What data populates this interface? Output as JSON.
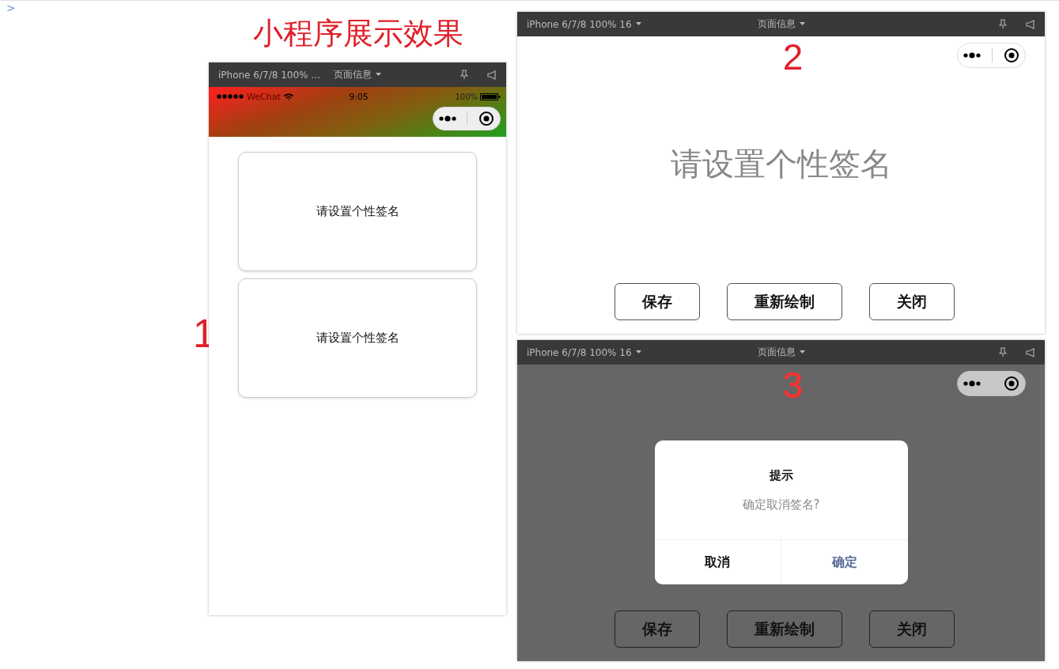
{
  "console_prompt": ">",
  "title": "小程序展示效果",
  "windows": [
    {
      "kind": "list",
      "number": "1",
      "device": "iPhone 6/7/8 100% ...",
      "device_caret": false,
      "page_menu": "页面信息",
      "status_bar": {
        "carrier": "WeChat",
        "time": "9:05",
        "battery": "100%"
      },
      "cards": [
        "请设置个性签名",
        "请设置个性签名"
      ]
    },
    {
      "kind": "canvas",
      "number": "2",
      "device": "iPhone 6/7/8 100% 16",
      "device_caret": true,
      "page_menu": "页面信息",
      "hint": "请设置个性签名",
      "buttons": [
        "保存",
        "重新绘制",
        "关闭"
      ]
    },
    {
      "kind": "dialog",
      "number": "3",
      "device": "iPhone 6/7/8 100% 16",
      "device_caret": true,
      "page_menu": "页面信息",
      "buttons": [
        "保存",
        "重新绘制",
        "关闭"
      ],
      "dialog": {
        "title": "提示",
        "message": "确定取消签名?",
        "actions": [
          {
            "label": "取消",
            "kind": "cancel"
          },
          {
            "label": "确定",
            "kind": "confirm"
          }
        ]
      }
    }
  ]
}
